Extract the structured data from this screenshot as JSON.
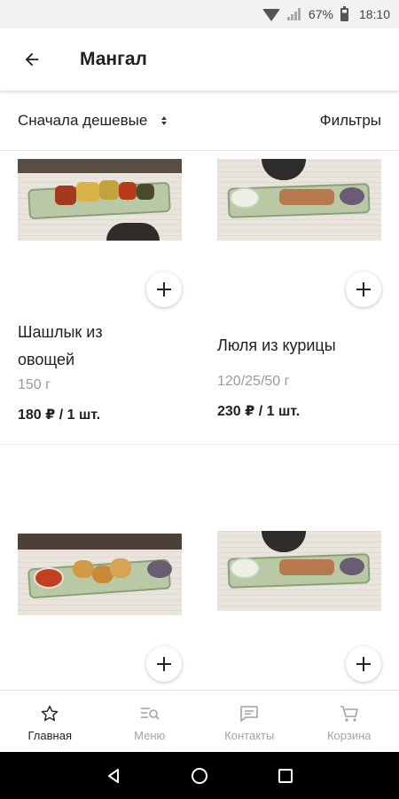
{
  "status_bar": {
    "battery": "67%",
    "time": "18:10"
  },
  "app_bar": {
    "title": "Мангал"
  },
  "sort_bar": {
    "sort_label": "Сначала дешевые",
    "filters_label": "Фильтры"
  },
  "products": [
    {
      "name": "Шашлык из овощей",
      "weight": "150 г",
      "price": "180 ₽ / 1 шт."
    },
    {
      "name": "Люля из курицы",
      "weight": "120/25/50 г",
      "price": "230 ₽ / 1 шт."
    },
    {
      "name": "",
      "weight": "",
      "price": ""
    },
    {
      "name": "",
      "weight": "",
      "price": ""
    }
  ],
  "bottom_nav": {
    "items": [
      {
        "label": "Главная",
        "icon": "star-icon",
        "active": true
      },
      {
        "label": "Меню",
        "icon": "menu-search-icon",
        "active": false
      },
      {
        "label": "Контакты",
        "icon": "chat-icon",
        "active": false
      },
      {
        "label": "Корзина",
        "icon": "cart-icon",
        "active": false
      }
    ]
  },
  "colors": {
    "accent_active": "#212121",
    "inactive": "#a3a3a3",
    "muted_text": "#9a9a9a"
  }
}
